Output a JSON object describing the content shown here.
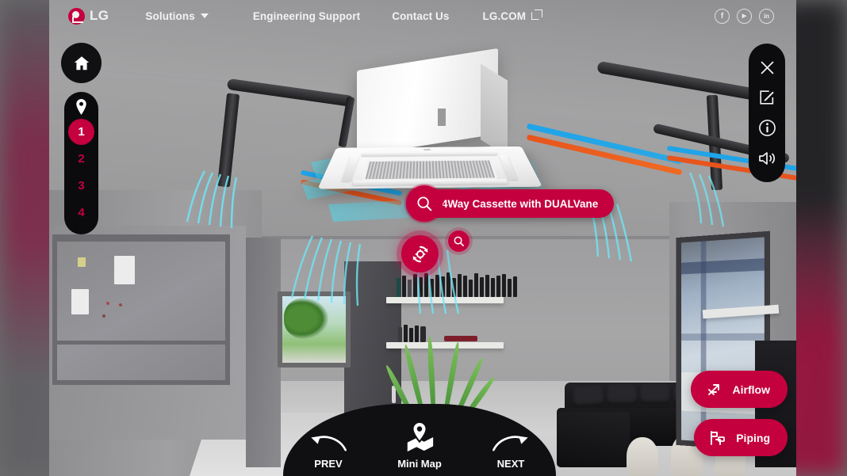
{
  "header": {
    "brand": "LG",
    "brand_logo_icon": "lg-logo-icon",
    "nav": [
      {
        "label": "Solutions",
        "icon": "chevron-down-icon",
        "has_caret": true
      },
      {
        "label": "Engineering Support",
        "has_caret": false
      },
      {
        "label": "Contact Us",
        "has_caret": false
      },
      {
        "label": "LG.COM",
        "icon": "external-link-icon",
        "has_external": true
      }
    ],
    "socials": [
      {
        "name": "facebook-icon",
        "glyph": "f"
      },
      {
        "name": "youtube-icon",
        "glyph": "▶"
      },
      {
        "name": "linkedin-icon",
        "glyph": "in"
      }
    ]
  },
  "left_controls": {
    "home_icon": "home-icon",
    "pin_icon": "location-pin-icon",
    "scenes": [
      {
        "label": "1",
        "active": true
      },
      {
        "label": "2",
        "active": false
      },
      {
        "label": "3",
        "active": false
      },
      {
        "label": "4",
        "active": false
      }
    ]
  },
  "tool_rail": [
    {
      "name": "close-icon",
      "label": "Close"
    },
    {
      "name": "edit-icon",
      "label": "Edit"
    },
    {
      "name": "info-icon",
      "label": "Info"
    },
    {
      "name": "sound-icon",
      "label": "Sound"
    }
  ],
  "hotspots": {
    "label": "4Way Cassette with DUALVane",
    "label_icon": "magnifier-icon",
    "rotate_icon": "rotate-360-icon",
    "search_icon": "magnifier-icon"
  },
  "actions": [
    {
      "label": "Airflow",
      "icon": "airflow-icon"
    },
    {
      "label": "Piping",
      "icon": "piping-icon"
    }
  ],
  "bottom_bar": {
    "prev": {
      "label": "PREV",
      "icon": "arrow-left-icon"
    },
    "mini_map": {
      "label": "Mini Map",
      "icon": "map-pin-icon"
    },
    "next": {
      "label": "NEXT",
      "icon": "arrow-right-icon"
    }
  },
  "colors": {
    "brand_red": "#C4003F",
    "panel_black": "#0B0B0D",
    "text_light": "#F2F2F2"
  }
}
